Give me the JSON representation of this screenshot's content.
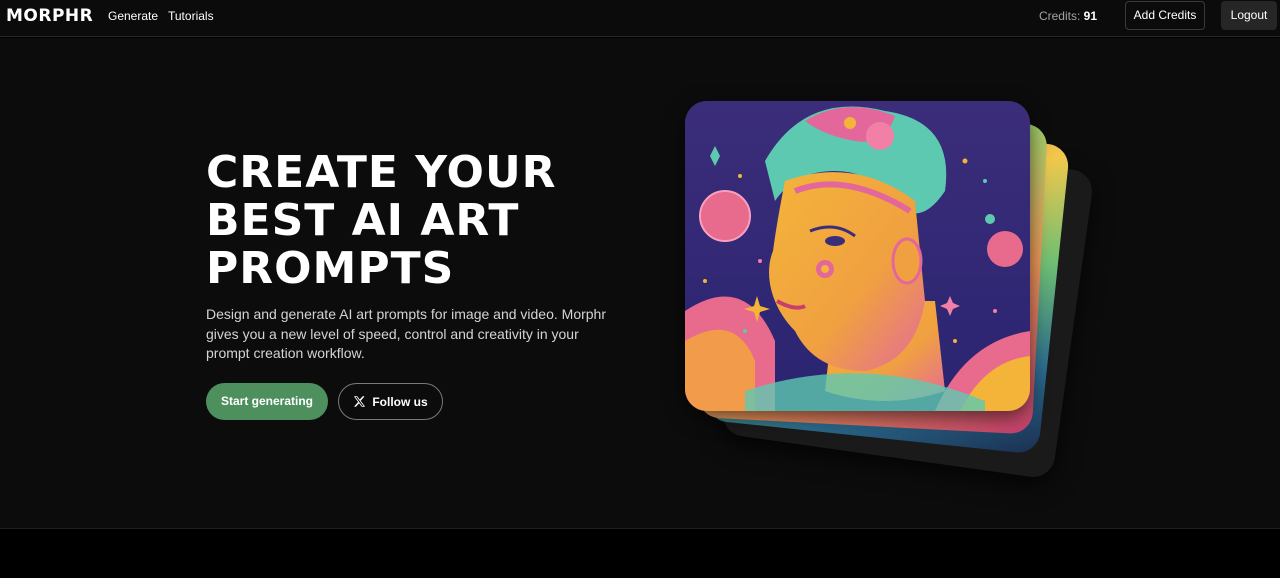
{
  "header": {
    "logo": "MORPHR",
    "nav": [
      {
        "label": "Generate"
      },
      {
        "label": "Tutorials"
      }
    ],
    "credits_label": "Credits:",
    "credits_value": "91",
    "add_credits_label": "Add Credits",
    "logout_label": "Logout"
  },
  "hero": {
    "title_lines": [
      "CREATE YOUR",
      "BEST AI ART",
      "PROMPTS"
    ],
    "description": "Design and generate AI art prompts for image and video. Morphr gives you a new level of speed, control and creativity in your prompt creation workflow.",
    "start_button": "Start generating",
    "follow_button": "Follow us"
  },
  "icons": {
    "follow_icon": "x-logo-icon"
  },
  "colors": {
    "accent_green": "#4e8f5e",
    "background": "#0c0c0c"
  }
}
